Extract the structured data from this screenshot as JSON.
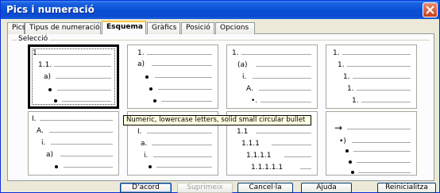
{
  "window": {
    "title": "Pics i numeració"
  },
  "tabs": [
    {
      "label": "Pics"
    },
    {
      "label": "Tipus de numeració"
    },
    {
      "label": "Esquema"
    },
    {
      "label": "Gràfics"
    },
    {
      "label": "Posició"
    },
    {
      "label": "Opcions"
    }
  ],
  "selection_group": {
    "label": "Selecció"
  },
  "schemes": [
    [
      "1.",
      "1.1.",
      "a)",
      "•",
      "•"
    ],
    [
      "1.",
      "a)",
      "•",
      "•",
      "•"
    ],
    [
      "1.",
      "(a)",
      "i.",
      "A.",
      "•."
    ],
    [
      "1.",
      "1.",
      "1.",
      "1.",
      "1."
    ],
    [
      "I.",
      "A.",
      "i.",
      "a)",
      "•"
    ],
    [
      "1.",
      "I.",
      "a.",
      "i.",
      "•"
    ],
    [
      "1.",
      "1.1",
      "1.1.1",
      "1.1.1.1",
      "1.1.1.1.1"
    ],
    [
      "→",
      "•)",
      "•",
      "•",
      "•"
    ]
  ],
  "tooltip": {
    "text": "Numeric, lowercase letters, solid small circular bullet"
  },
  "buttons": {
    "ok": "D'acord",
    "remove": "Suprimeix",
    "cancel": "Cancel·la",
    "help": "Ajuda",
    "reset": "Reinicialitza"
  }
}
